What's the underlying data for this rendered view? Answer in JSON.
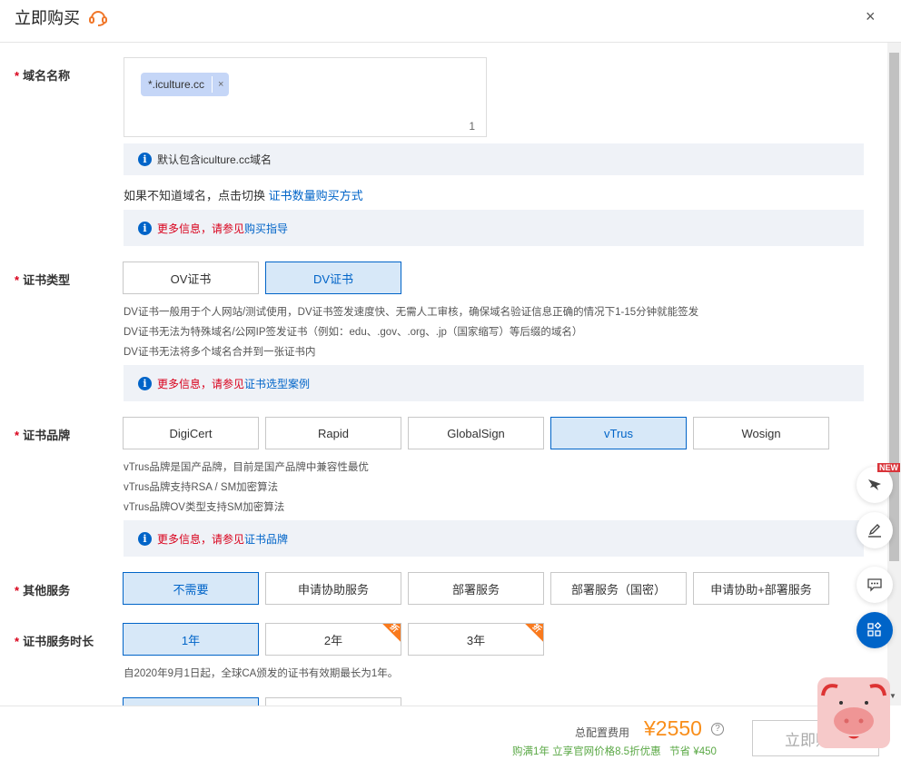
{
  "header": {
    "title": "立即购买",
    "close": "×"
  },
  "domain": {
    "label": "域名名称",
    "tag": "*.iculture.cc",
    "tag_remove": "×",
    "count": "1",
    "info": "默认包含iculture.cc域名",
    "switch_text": "如果不知道域名，点击切换 ",
    "switch_link": "证书数量购买方式",
    "more_red": "更多信息，请参见",
    "more_link": "购买指导"
  },
  "cert_type": {
    "label": "证书类型",
    "options": [
      "OV证书",
      "DV证书"
    ],
    "selected": 1,
    "desc": [
      "DV证书一般用于个人网站/测试使用，DV证书签发速度快、无需人工审核，确保域名验证信息正确的情况下1-15分钟就能签发",
      "DV证书无法为特殊域名/公网IP签发证书（例如：edu、.gov、.org、.jp（国家缩写）等后缀的域名）",
      "DV证书无法将多个域名合并到一张证书内"
    ],
    "more_red": "更多信息，请参见",
    "more_link": "证书选型案例"
  },
  "brand": {
    "label": "证书品牌",
    "options": [
      "DigiCert",
      "Rapid",
      "GlobalSign",
      "vTrus",
      "Wosign"
    ],
    "selected": 3,
    "desc": [
      "vTrus品牌是国产品牌，目前是国产品牌中兼容性最优",
      "vTrus品牌支持RSA / SM加密算法",
      "vTrus品牌OV类型支持SM加密算法"
    ],
    "more_red": "更多信息，请参见",
    "more_link": "证书品牌"
  },
  "service": {
    "label": "其他服务",
    "options": [
      "不需要",
      "申请协助服务",
      "部署服务",
      "部署服务（国密）",
      "申请协助+部署服务"
    ],
    "selected": 0
  },
  "duration": {
    "label": "证书服务时长",
    "options": [
      "1年",
      "2年",
      "3年"
    ],
    "selected": 0,
    "badge": "折",
    "note": "自2020年9月1日起，全球CA颁发的证书有效期最长为1年。"
  },
  "side": {
    "new_badge": "NEW"
  },
  "footer": {
    "total_label": "总配置费用",
    "price": "¥2550",
    "help": "?",
    "promo": "购满1年 立享官网价格8.5折优惠",
    "save": "节省 ¥450",
    "buy": "立即购买"
  },
  "colors": {
    "accent": "#0064c8",
    "price": "#f98e1a",
    "promo": "#5aa845",
    "badge": "#f97a1e"
  }
}
